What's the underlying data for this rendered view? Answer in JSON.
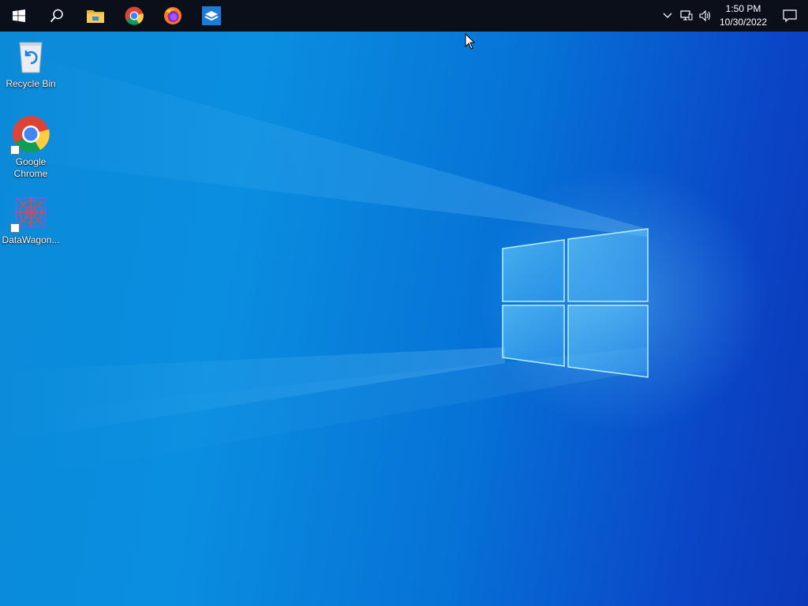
{
  "taskbar": {
    "start_icon": "windows-logo-icon",
    "search_icon": "search-icon",
    "pinned_apps": [
      {
        "name": "file-explorer",
        "icon": "folder-icon"
      },
      {
        "name": "google-chrome",
        "icon": "chrome-icon"
      },
      {
        "name": "firefox",
        "icon": "firefox-icon"
      },
      {
        "name": "virtualbox-like-app",
        "icon": "app-box-icon"
      }
    ],
    "tray": {
      "overflow_icon": "chevron-up-icon",
      "network_icon": "network-icon",
      "volume_icon": "volume-icon",
      "time": "1:50 PM",
      "date": "10/30/2022",
      "notification_icon": "action-center-icon"
    }
  },
  "desktop": {
    "icons": [
      {
        "label": "Recycle Bin",
        "icon": "recycle-bin-icon",
        "shortcut": false
      },
      {
        "label": "Google\nChrome",
        "icon": "chrome-icon",
        "shortcut": true
      },
      {
        "label": "DataWagon...",
        "icon": "datawagon-icon",
        "shortcut": true
      }
    ]
  },
  "colors": {
    "taskbar_bg": "#0a0f1a",
    "desktop_blue": "#0a8ee0",
    "desktop_deep_blue": "#0b38b8"
  }
}
